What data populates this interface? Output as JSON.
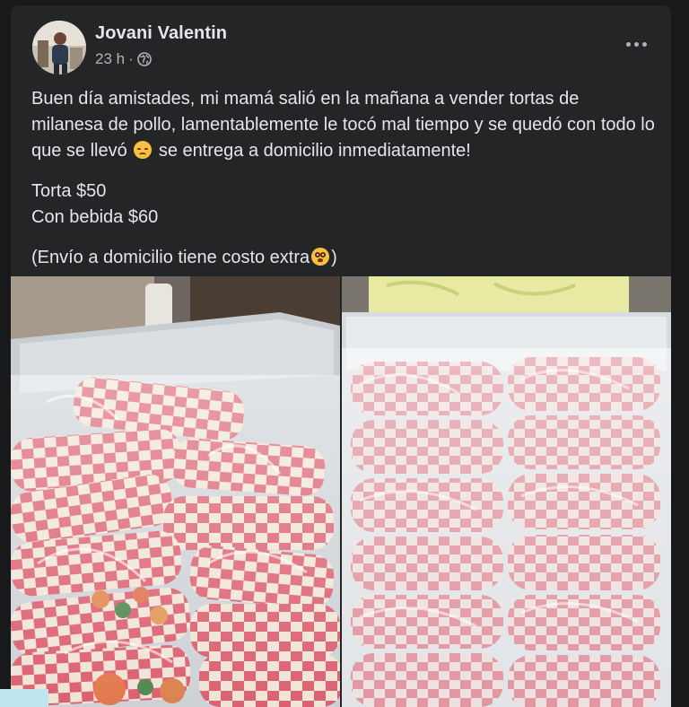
{
  "post": {
    "author": "Jovani Valentin",
    "time": "23 h",
    "audience_icon": "globe-icon",
    "more_icon": "more-options-icon",
    "paragraphs": {
      "p1_a": "Buen día amistades, mi mamá salió en la mañana a vender tortas de milanesa de pollo, lamentablemente le tocó mal tiempo y se quedó con todo lo que se llevó",
      "p1_b": "se entrega a domicilio inmediatamente!",
      "p2_line1": "Torta $50",
      "p2_line2": "Con bebida $60",
      "p3_a": "(Envío a domicilio tiene costo extra",
      "p3_b": ")"
    },
    "emojis": [
      "disappointed-face-emoji",
      "pleading-face-emoji"
    ],
    "photos": [
      "tortas-photo-left",
      "tortas-photo-right"
    ]
  },
  "colors": {
    "background": "#18191a",
    "card": "#242526",
    "primary_text": "#e4e6eb",
    "secondary_text": "#b0b3b8",
    "wrapper_red": "#d94b5a"
  }
}
